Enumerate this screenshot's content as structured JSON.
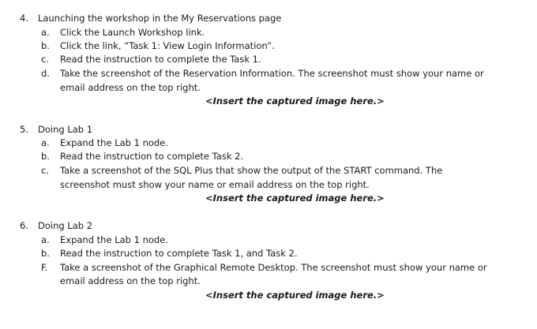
{
  "sections": [
    {
      "number": "4.",
      "title": "Launching the workshop in the My Reservations page",
      "items": [
        {
          "label": "a.",
          "text": "Click the Launch Workshop link."
        },
        {
          "label": "b.",
          "text": "Click the link, “Task 1: View Login Information”."
        },
        {
          "label": "c.",
          "text": "Read the instruction to complete the Task 1."
        },
        {
          "label": "d.",
          "text": "Take the screenshot of the Reservation Information. The screenshot must show your name or",
          "cont": "email address on the top right."
        }
      ],
      "insert": "<Insert the captured image here.>"
    },
    {
      "number": "5.",
      "title": "Doing Lab 1",
      "items": [
        {
          "label": "a.",
          "text": "Expand the Lab 1 node."
        },
        {
          "label": "b.",
          "text": "Read the instruction to complete Task 2."
        },
        {
          "label": "c.",
          "text": "Take a screenshot of the SQL Plus that show the output of the START command. The",
          "cont": "screenshot must show your name or email address on the top right."
        }
      ],
      "insert": "<Insert the captured image here.>"
    },
    {
      "number": "6.",
      "title": "Doing Lab 2",
      "items": [
        {
          "label": "a.",
          "text": "Expand the Lab 1 node."
        },
        {
          "label": "b.",
          "text": "Read the instruction to complete Task 1, and Task 2."
        },
        {
          "label": "F.",
          "text": "Take a screenshot of the Graphical Remote Desktop. The screenshot must show your name or",
          "cont": "email address on the top right."
        }
      ],
      "insert": "<Insert the captured image here.>"
    }
  ]
}
